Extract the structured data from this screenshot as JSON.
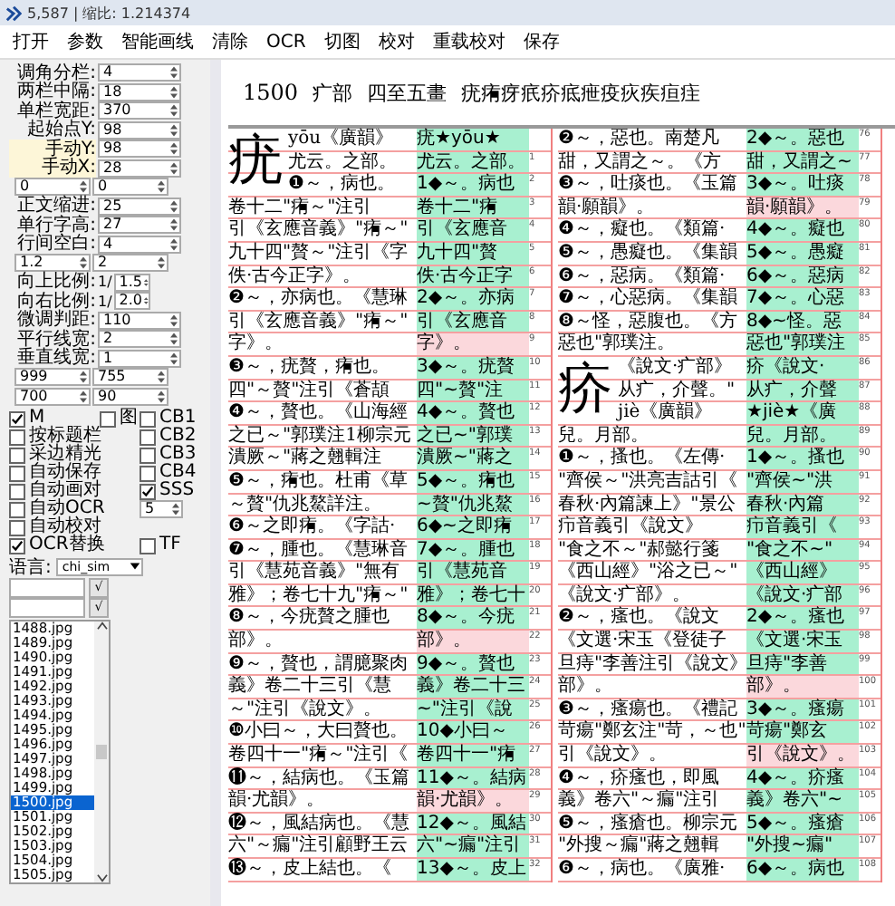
{
  "window": {
    "title": "5,587 | 缩比: 1.214374"
  },
  "menu": [
    "打开",
    "参数",
    "智能画线",
    "清除",
    "OCR",
    "切图",
    "校对",
    "重载校对",
    "保存"
  ],
  "params": [
    {
      "kind": "spin",
      "label": "调角分栏:",
      "value": "4",
      "highlight": false
    },
    {
      "kind": "spin",
      "label": "两栏中隔:",
      "value": "18",
      "highlight": false
    },
    {
      "kind": "spin",
      "label": "单栏宽距:",
      "value": "370",
      "highlight": false
    },
    {
      "kind": "spin",
      "label": "起始点Y:",
      "value": "98",
      "highlight": false
    },
    {
      "kind": "spin",
      "label": "手动Y:",
      "value": "98",
      "highlight": true
    },
    {
      "kind": "spin",
      "label": "手动X:",
      "value": "28",
      "highlight": true
    },
    {
      "kind": "pair",
      "values": [
        "0",
        "0"
      ]
    },
    {
      "kind": "spin",
      "label": "正文缩进:",
      "value": "25",
      "highlight": false
    },
    {
      "kind": "spin",
      "label": "单行字高:",
      "value": "27",
      "highlight": false
    },
    {
      "kind": "spin",
      "label": "行间空白:",
      "value": "4",
      "highlight": false
    },
    {
      "kind": "pair",
      "values": [
        "1.2",
        "2"
      ]
    },
    {
      "kind": "ratio",
      "label": "向上比例:",
      "prefix": "1/",
      "value": "1.5"
    },
    {
      "kind": "ratio",
      "label": "向右比例:",
      "prefix": "1/",
      "value": "2.0"
    },
    {
      "kind": "spin",
      "label": "微调判距:",
      "value": "110",
      "highlight": false
    },
    {
      "kind": "spin",
      "label": "平行线宽:",
      "value": "2",
      "highlight": false
    },
    {
      "kind": "spin",
      "label": "垂直线宽:",
      "value": "1",
      "highlight": false
    },
    {
      "kind": "pair",
      "values": [
        "999",
        "755"
      ]
    },
    {
      "kind": "pair",
      "values": [
        "700",
        "90"
      ]
    }
  ],
  "options": [
    {
      "kind": "check",
      "label": "M",
      "checked": true
    },
    {
      "kind": "check",
      "label": "图",
      "checked": false
    },
    {
      "kind": "check",
      "label": "CB1",
      "checked": false
    },
    {
      "kind": "check",
      "label": "按标题栏",
      "checked": false
    },
    {
      "kind": "none"
    },
    {
      "kind": "check",
      "label": "CB2",
      "checked": false
    },
    {
      "kind": "check",
      "label": "采边精光",
      "checked": false
    },
    {
      "kind": "none"
    },
    {
      "kind": "check",
      "label": "CB3",
      "checked": false
    },
    {
      "kind": "check",
      "label": "自动保存",
      "checked": false
    },
    {
      "kind": "none"
    },
    {
      "kind": "check",
      "label": "CB4",
      "checked": false
    },
    {
      "kind": "check",
      "label": "自动画对",
      "checked": false
    },
    {
      "kind": "none"
    },
    {
      "kind": "check",
      "label": "SSS",
      "checked": true
    },
    {
      "kind": "check",
      "label": "自动OCR",
      "checked": false
    },
    {
      "kind": "none"
    },
    {
      "kind": "spin",
      "value": "5"
    },
    {
      "kind": "check",
      "label": "自动校对",
      "checked": false
    },
    {
      "kind": "none"
    },
    {
      "kind": "none"
    },
    {
      "kind": "check",
      "label": "OCR替换",
      "checked": true
    },
    {
      "kind": "none"
    },
    {
      "kind": "check",
      "label": "TF",
      "checked": false
    }
  ],
  "language": {
    "label": "语言:",
    "value": "chi_sim"
  },
  "small_fields": [
    {
      "button": "√"
    },
    {
      "button": "√"
    }
  ],
  "files": [
    {
      "name": "1488.jpg",
      "selected": false
    },
    {
      "name": "1489.jpg",
      "selected": false
    },
    {
      "name": "1490.jpg",
      "selected": false
    },
    {
      "name": "1491.jpg",
      "selected": false
    },
    {
      "name": "1492.jpg",
      "selected": false
    },
    {
      "name": "1493.jpg",
      "selected": false
    },
    {
      "name": "1494.jpg",
      "selected": false
    },
    {
      "name": "1495.jpg",
      "selected": false
    },
    {
      "name": "1496.jpg",
      "selected": false
    },
    {
      "name": "1497.jpg",
      "selected": false
    },
    {
      "name": "1498.jpg",
      "selected": false
    },
    {
      "name": "1499.jpg",
      "selected": false
    },
    {
      "name": "1500.jpg",
      "selected": true
    },
    {
      "name": "1501.jpg",
      "selected": false
    },
    {
      "name": "1502.jpg",
      "selected": false
    },
    {
      "name": "1503.jpg",
      "selected": false
    },
    {
      "name": "1504.jpg",
      "selected": false
    },
    {
      "name": "1505.jpg",
      "selected": false
    }
  ],
  "page": {
    "header": {
      "page": "1500",
      "section": "疒部",
      "strokes": "四至五畫",
      "chars": "疣痏疨疧疥疷疶疫疢疾疸疰"
    },
    "columns": [
      {
        "rows": [
          {
            "headword": "疣",
            "scan": "yōu《廣韻》",
            "ocr": "疣★yōu★",
            "ok": true
          },
          {
            "scan": "尤云。之部。",
            "ocr": "尤云。之部。",
            "num": "1",
            "ok": true
          },
          {
            "scan": "❶～，病也。",
            "ocr": "1◆～。病也",
            "num": "2",
            "ok": true
          },
          {
            "scan": "卷十二\"痏～\"注引",
            "ocr": "卷十二\"痏",
            "num": "3",
            "ok": true
          },
          {
            "scan": "引《玄應音義》\"痏～\"",
            "ocr": "引《玄應音",
            "num": "4",
            "ok": true
          },
          {
            "scan": "九十四\"贅～\"注引《字",
            "ocr": "九十四\"贅",
            "num": "5",
            "ok": true
          },
          {
            "scan": "佚·古今正字》。",
            "ocr": "佚·古今正字",
            "num": "6",
            "ok": true
          },
          {
            "scan": "❷～，亦病也。《慧琳",
            "ocr": "2◆～。亦病",
            "num": "7",
            "ok": true
          },
          {
            "scan": "引《玄應音義》\"痏～\"",
            "ocr": "引《玄應音",
            "num": "8",
            "ok": true
          },
          {
            "scan": "字》。",
            "ocr": "字》。",
            "num": "9",
            "ok": false
          },
          {
            "scan": "❸～，疣贅，痏也。",
            "ocr": "3◆～。疣贅",
            "num": "10",
            "ok": true
          },
          {
            "scan": "四\"～贅\"注引《蒼頡",
            "ocr": "四\"~贅\"注",
            "num": "11",
            "ok": true
          },
          {
            "scan": "❹～，贅也。《山海經",
            "ocr": "4◆～。贅也",
            "num": "12",
            "ok": true
          },
          {
            "scan": "之已～\"郭璞注1柳宗元",
            "ocr": "之已~\"郭璞",
            "num": "13",
            "ok": true
          },
          {
            "scan": "潰厥～\"蔣之翹輯注",
            "ocr": "潰厥~\"蔣之",
            "num": "14",
            "ok": true
          },
          {
            "scan": "❺～，痏也。杜甫《草",
            "ocr": "5◆～。痏也",
            "num": "15",
            "ok": true
          },
          {
            "scan": "～贅\"仇兆鰲詳注。",
            "ocr": "~贅\"仇兆鰲",
            "num": "16",
            "ok": true
          },
          {
            "scan": "❻～之即痏。《字詁·",
            "ocr": "6◆~之即痏",
            "num": "17",
            "ok": true
          },
          {
            "scan": "❼～，腫也。《慧琳音",
            "ocr": "7◆～。腫也",
            "num": "18",
            "ok": true
          },
          {
            "scan": "引《慧苑音義》\"無有",
            "ocr": "引《慧苑音",
            "num": "19",
            "ok": true
          },
          {
            "scan": "雅》；卷七十九\"痏～\"",
            "ocr": "雅》；卷七十",
            "num": "20",
            "ok": true
          },
          {
            "scan": "❽～，今疣贅之腫也",
            "ocr": "8◆～。今疣",
            "num": "21",
            "ok": true
          },
          {
            "scan": "部》。",
            "ocr": "部》。",
            "num": "22",
            "ok": false
          },
          {
            "scan": "❾～，贅也，謂臆聚肉",
            "ocr": "9◆～。贅也",
            "num": "23",
            "ok": true
          },
          {
            "scan": "義》卷二十三引《慧",
            "ocr": "義》卷二十三",
            "num": "24",
            "ok": true
          },
          {
            "scan": "～\"注引《說文》。",
            "ocr": "~\"注引《說",
            "num": "25",
            "ok": true
          },
          {
            "scan": "❿小曰～，大曰贅也。",
            "ocr": "10◆小曰～",
            "num": "26",
            "ok": true
          },
          {
            "scan": "卷四十一\"痏～\"注引《",
            "ocr": "卷四十一\"痏",
            "num": "27",
            "ok": true
          },
          {
            "scan": "⓫～，結病也。《玉篇",
            "ocr": "11◆～。結病",
            "num": "28",
            "ok": true
          },
          {
            "scan": "韻·尤韻》。",
            "ocr": "韻·尤韻》。",
            "num": "29",
            "ok": false
          },
          {
            "scan": "⓬～，風結病也。《慧",
            "ocr": "12◆～。風結",
            "num": "30",
            "ok": true
          },
          {
            "scan": "六\"～瘺\"注引顧野王云",
            "ocr": "六\"~瘺\"注引",
            "num": "31",
            "ok": true
          },
          {
            "scan": "⓭～，皮上結也。《",
            "ocr": "13◆～。皮上",
            "num": "32",
            "ok": true
          }
        ]
      },
      {
        "rows": [
          {
            "scan": "❷～，惡也。南楚凡",
            "ocr": "2◆～。惡也",
            "num": "76",
            "ok": true
          },
          {
            "scan": "甜，又謂之～。《方",
            "ocr": "甜，又謂之~",
            "num": "77",
            "ok": true
          },
          {
            "scan": "❸～，吐痰也。《玉篇",
            "ocr": "3◆～。吐痰",
            "num": "78",
            "ok": true
          },
          {
            "scan": "韻·願韻》。",
            "ocr": "韻·願韻》。",
            "num": "79",
            "ok": false
          },
          {
            "scan": "❹～，癡也。《類篇·",
            "ocr": "4◆～。癡也",
            "num": "80",
            "ok": true
          },
          {
            "scan": "❺～，愚癡也。《集韻",
            "ocr": "5◆～。愚癡",
            "num": "81",
            "ok": true
          },
          {
            "scan": "❻～，惡病。《類篇·",
            "ocr": "6◆～。惡病",
            "num": "82",
            "ok": true
          },
          {
            "scan": "❼～，心惡病。《集韻",
            "ocr": "7◆～。心惡",
            "num": "83",
            "ok": true
          },
          {
            "scan": "❽～怪，惡腹也。《方",
            "ocr": "8◆~怪。惡",
            "num": "84",
            "ok": true
          },
          {
            "scan": "惡也\"郭璞注。",
            "ocr": "惡也\"郭璞注",
            "num": "85",
            "ok": true
          },
          {
            "headword": "疥",
            "scan": "《說文·疒部》",
            "ocr": "疥《說文·",
            "num": "86",
            "ok": true
          },
          {
            "scan": "从疒，介聲。\"",
            "ocr": "从疒，介聲",
            "num": "87",
            "ok": true
          },
          {
            "scan": "jiè《廣韻》",
            "ocr": "★jiè★《廣",
            "num": "88",
            "ok": true
          },
          {
            "scan": "兒。月部。",
            "ocr": "兒。月部。",
            "num": "89",
            "ok": true
          },
          {
            "scan": "❶～，搔也。《左傳·",
            "ocr": "1◆～。搔也",
            "num": "90",
            "ok": true
          },
          {
            "scan": "\"齊侯～\"洪亮吉詁引《",
            "ocr": "\"齊侯~\"洪",
            "num": "91",
            "ok": true
          },
          {
            "scan": "春秋·內篇諫上》\"景公",
            "ocr": "春秋·內篇",
            "num": "92",
            "ok": true
          },
          {
            "scan": "疖音義引《說文》",
            "ocr": "疖音義引《",
            "num": "93",
            "ok": true
          },
          {
            "scan": "\"食之不～\"郝懿行箋",
            "ocr": "\"食之不~\"",
            "num": "94",
            "ok": true
          },
          {
            "scan": "《西山經》\"浴之已～\"",
            "ocr": "《西山經》",
            "num": "95",
            "ok": true
          },
          {
            "scan": "《說文·疒部》。",
            "ocr": "《說文·疒部",
            "num": "96",
            "ok": true
          },
          {
            "scan": "❷～，瘙也。《說文",
            "ocr": "2◆～。瘙也",
            "num": "97",
            "ok": true
          },
          {
            "scan": "《文選·宋玉《登徒子",
            "ocr": "《文選·宋玉",
            "num": "98",
            "ok": true
          },
          {
            "scan": "旦痔\"李善注引《說文》",
            "ocr": "旦痔\"李善",
            "num": "99",
            "ok": true
          },
          {
            "scan": "部》。",
            "ocr": "部》。",
            "num": "100",
            "ok": false
          },
          {
            "scan": "❸～，瘙瘍也。《禮記",
            "ocr": "3◆～。瘙瘍",
            "num": "101",
            "ok": true
          },
          {
            "scan": "苛瘍\"鄭玄注\"苛，～也\"",
            "ocr": "苛瘍\"鄭玄",
            "num": "102",
            "ok": true
          },
          {
            "scan": "引《說文》。",
            "ocr": "引《說文》。",
            "num": "103",
            "ok": false
          },
          {
            "scan": "❹～，疥瘙也，即風",
            "ocr": "4◆～。疥瘙",
            "num": "104",
            "ok": true
          },
          {
            "scan": "義》卷六\"～瘺\"注引",
            "ocr": "義》卷六\"~",
            "num": "105",
            "ok": true
          },
          {
            "scan": "❺～，瘙瘡也。柳宗元",
            "ocr": "5◆～。瘙瘡",
            "num": "106",
            "ok": true
          },
          {
            "scan": "\"外搜～瘺\"蔣之翹輯",
            "ocr": "\"外搜~瘺\"",
            "num": "107",
            "ok": true
          },
          {
            "scan": "❻～，病也。《廣雅·",
            "ocr": "6◆～。病也",
            "num": "108",
            "ok": true
          }
        ]
      }
    ]
  }
}
